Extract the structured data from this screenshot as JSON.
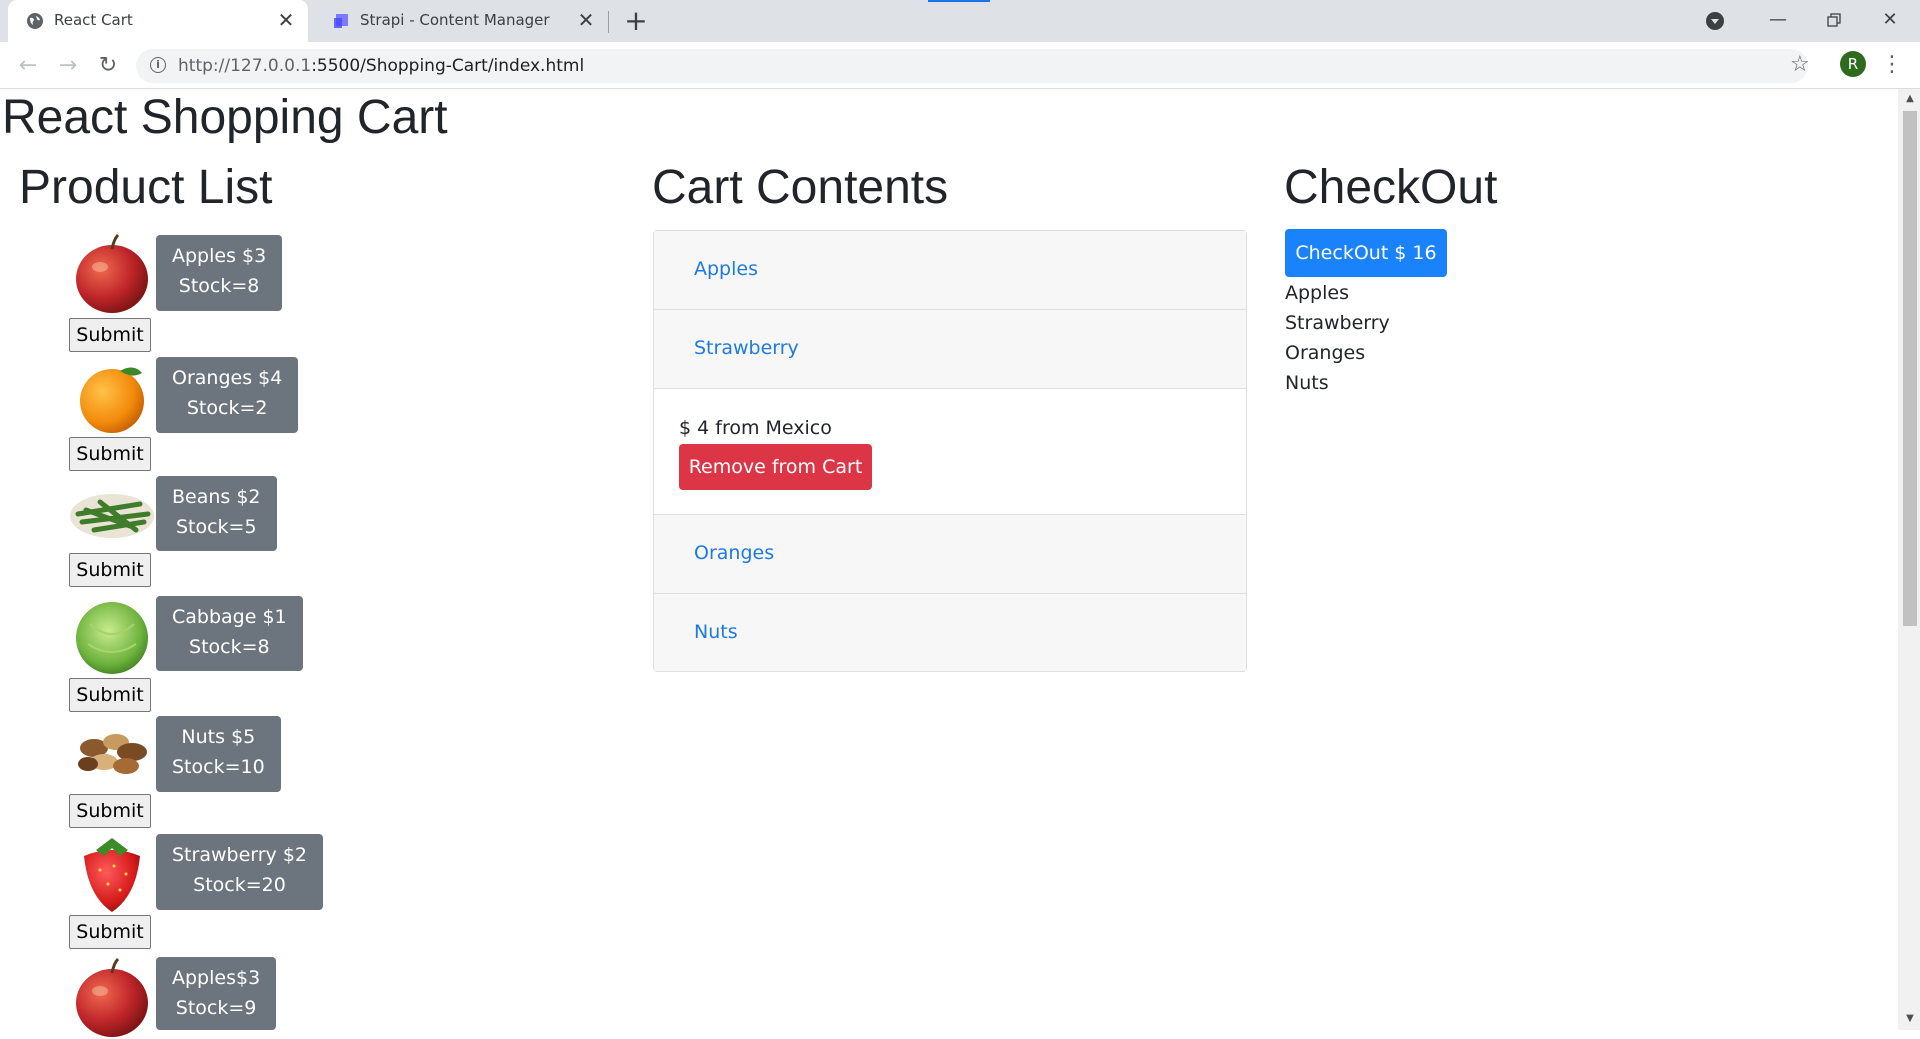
{
  "browser": {
    "tabs": [
      {
        "title": "React Cart",
        "active": true,
        "icon": "globe-icon"
      },
      {
        "title": "Strapi - Content Manager",
        "active": false,
        "icon": "strapi-icon"
      }
    ],
    "url_host": "http://127.0.0.1",
    "url_path": ":5500/Shopping-Cart/index.html",
    "profile_initial": "R"
  },
  "page": {
    "title": "React Shopping Cart",
    "product_list": {
      "heading": "Product List",
      "submit_label": "Submit",
      "products": [
        {
          "name": "Apples",
          "line1": "Apples $3",
          "line2": "Stock=8",
          "icon": "apple-image"
        },
        {
          "name": "Oranges",
          "line1": "Oranges $4",
          "line2": "Stock=2",
          "icon": "orange-image"
        },
        {
          "name": "Beans",
          "line1": "Beans $2",
          "line2": "Stock=5",
          "icon": "beans-image"
        },
        {
          "name": "Cabbage",
          "line1": "Cabbage $1",
          "line2": "Stock=8",
          "icon": "cabbage-image"
        },
        {
          "name": "Nuts",
          "line1": "Nuts $5",
          "line2": "Stock=10",
          "icon": "nuts-image"
        },
        {
          "name": "Strawberry",
          "line1": "Strawberry $2",
          "line2": "Stock=20",
          "icon": "strawberry-image"
        },
        {
          "name": "Apples",
          "line1": "Apples$3",
          "line2": "Stock=9",
          "icon": "apple-image"
        }
      ]
    },
    "cart": {
      "heading": "Cart Contents",
      "items": [
        "Apples",
        "Strawberry",
        "Oranges",
        "Nuts"
      ],
      "expanded_info": "$ 4 from Mexico",
      "remove_label": "Remove from Cart"
    },
    "checkout": {
      "heading": "CheckOut",
      "button_label": "CheckOut $ 16",
      "items": [
        "Apples",
        "Strawberry",
        "Oranges",
        "Nuts"
      ]
    }
  },
  "colors": {
    "primary": "#1a82fb",
    "secondary": "#6c757d",
    "danger": "#dc3545",
    "link": "#1f7ae0"
  }
}
